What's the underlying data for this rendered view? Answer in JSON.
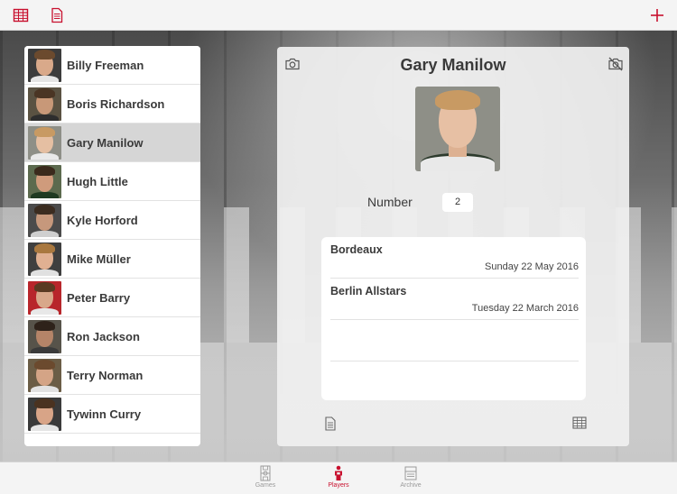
{
  "colors": {
    "accent": "#c8102e",
    "inactive": "#9a9a9a",
    "selected_row": "#d6d6d6"
  },
  "toolbar": {
    "left_icons": [
      "table-icon",
      "document-icon"
    ],
    "right_icon": "plus-icon"
  },
  "players": [
    {
      "name": "Billy Freeman",
      "skin": "#d9a98a",
      "hair": "#6b4a2e",
      "bg": "#3c3c3c",
      "shirt": "#e5e5e5"
    },
    {
      "name": "Boris Richardson",
      "skin": "#c89878",
      "hair": "#4a3524",
      "bg": "#5a5242",
      "shirt": "#2e2e2e"
    },
    {
      "name": "Gary Manilow",
      "skin": "#e5bfa2",
      "hair": "#c89a63",
      "bg": "#8e8f87",
      "shirt": "#e9e9e9"
    },
    {
      "name": "Hugh Little",
      "skin": "#cf9b7c",
      "hair": "#3a2a1c",
      "bg": "#5c6a4e",
      "shirt": "#1f3a22"
    },
    {
      "name": "Kyle Horford",
      "skin": "#c6987c",
      "hair": "#3b2c20",
      "bg": "#4b4b4b",
      "shirt": "#cfcfcf"
    },
    {
      "name": "Mike Müller",
      "skin": "#e0b092",
      "hair": "#a9783f",
      "bg": "#3f3f3f",
      "shirt": "#e0e0e0"
    },
    {
      "name": "Peter Barry",
      "skin": "#d8a88a",
      "hair": "#5a3a22",
      "bg": "#b8262b",
      "shirt": "#e8e8e8"
    },
    {
      "name": "Ron Jackson",
      "skin": "#b58468",
      "hair": "#2e221a",
      "bg": "#57534a",
      "shirt": "#3a3a3a"
    },
    {
      "name": "Terry Norman",
      "skin": "#d4a486",
      "hair": "#6b4a2e",
      "bg": "#6b5d46",
      "shirt": "#e2e2e2"
    },
    {
      "name": "Tywinn Curry",
      "skin": "#d8a487",
      "hair": "#4a3220",
      "bg": "#3a3a3a",
      "shirt": "#e4e4e4"
    }
  ],
  "selected_player": "Gary Manilow",
  "detail": {
    "title": "Gary Manilow",
    "number_label": "Number",
    "number_value": "2",
    "games": [
      {
        "team": "Bordeaux",
        "date": "Sunday 22 May 2016"
      },
      {
        "team": "Berlin Allstars",
        "date": "Tuesday 22 March 2016"
      }
    ]
  },
  "tabs": [
    {
      "label": "Games",
      "icon": "court-icon",
      "active": false
    },
    {
      "label": "Players",
      "icon": "player-icon",
      "active": true
    },
    {
      "label": "Archive",
      "icon": "archive-icon",
      "active": false
    }
  ]
}
